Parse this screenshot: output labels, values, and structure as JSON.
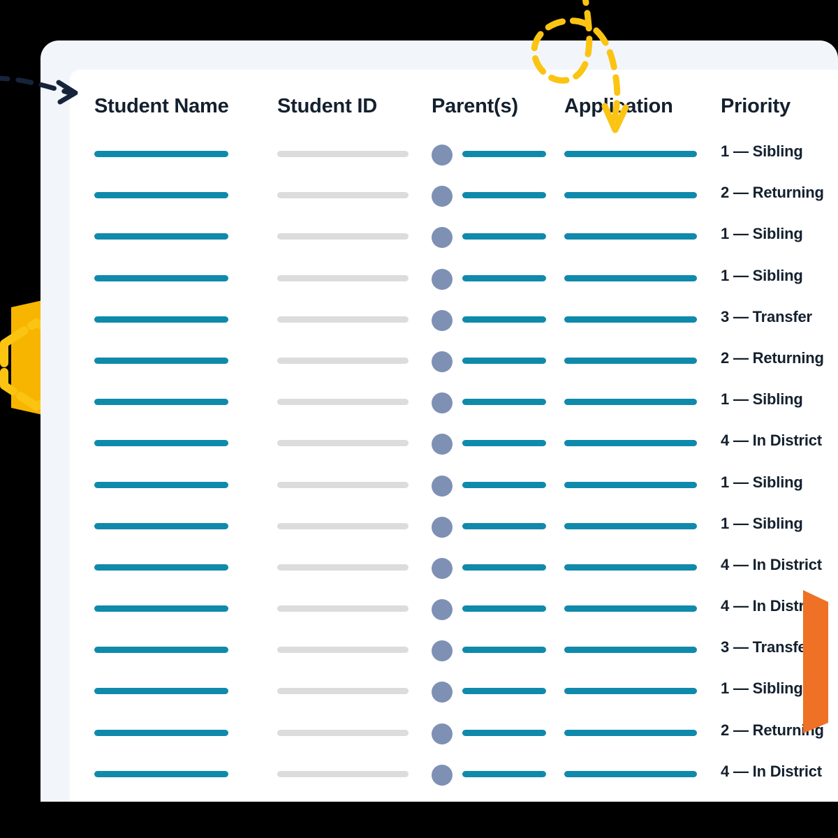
{
  "theme": {
    "page_background": "#000000",
    "outer_card": "#F2F6FA",
    "inner_card": "#FFFFFF",
    "accent_teal": "#0F8AAB",
    "placeholder_gray": "#DCDCDC",
    "avatar_slate": "#7E91B4",
    "text_dark": "#14202E",
    "decor_yellow": "#FBC412",
    "decor_orange": "#EE7125",
    "decor_navy": "#16243B"
  },
  "table": {
    "columns": [
      {
        "key": "student_name",
        "label": "Student Name"
      },
      {
        "key": "student_id",
        "label": "Student ID"
      },
      {
        "key": "parents",
        "label": "Parent(s)"
      },
      {
        "key": "application",
        "label": "Application"
      },
      {
        "key": "priority",
        "label": "Priority"
      }
    ],
    "rows": [
      {
        "student_name": "",
        "student_id": "",
        "parents": "",
        "application": "",
        "priority": "1 — Sibling"
      },
      {
        "student_name": "",
        "student_id": "",
        "parents": "",
        "application": "",
        "priority": "2 — Returning"
      },
      {
        "student_name": "",
        "student_id": "",
        "parents": "",
        "application": "",
        "priority": "1 — Sibling"
      },
      {
        "student_name": "",
        "student_id": "",
        "parents": "",
        "application": "",
        "priority": "1 — Sibling"
      },
      {
        "student_name": "",
        "student_id": "",
        "parents": "",
        "application": "",
        "priority": "3 — Transfer"
      },
      {
        "student_name": "",
        "student_id": "",
        "parents": "",
        "application": "",
        "priority": "2 — Returning"
      },
      {
        "student_name": "",
        "student_id": "",
        "parents": "",
        "application": "",
        "priority": "1 — Sibling"
      },
      {
        "student_name": "",
        "student_id": "",
        "parents": "",
        "application": "",
        "priority": "4 — In District"
      },
      {
        "student_name": "",
        "student_id": "",
        "parents": "",
        "application": "",
        "priority": "1 — Sibling"
      },
      {
        "student_name": "",
        "student_id": "",
        "parents": "",
        "application": "",
        "priority": "1 — Sibling"
      },
      {
        "student_name": "",
        "student_id": "",
        "parents": "",
        "application": "",
        "priority": "4 — In District"
      },
      {
        "student_name": "",
        "student_id": "",
        "parents": "",
        "application": "",
        "priority": "4 — In District"
      },
      {
        "student_name": "",
        "student_id": "",
        "parents": "",
        "application": "",
        "priority": "3 — Transfer"
      },
      {
        "student_name": "",
        "student_id": "",
        "parents": "",
        "application": "",
        "priority": "1 — Sibling"
      },
      {
        "student_name": "",
        "student_id": "",
        "parents": "",
        "application": "",
        "priority": "2 — Returning"
      },
      {
        "student_name": "",
        "student_id": "",
        "parents": "",
        "application": "",
        "priority": "4 — In District"
      }
    ]
  },
  "decorations": [
    {
      "name": "dashed-arrow-left",
      "color": "#16243B",
      "style": "dashed",
      "direction": "right"
    },
    {
      "name": "dashed-arrow-top",
      "color": "#FBC412",
      "style": "dashed",
      "direction": "down"
    },
    {
      "name": "hexagon-outline",
      "color": "#FBC412",
      "style": "dashed"
    },
    {
      "name": "hexagon-solid",
      "color": "#F5A800",
      "style": "solid"
    },
    {
      "name": "orange-ribbon",
      "color": "#EE7125",
      "style": "solid"
    }
  ]
}
